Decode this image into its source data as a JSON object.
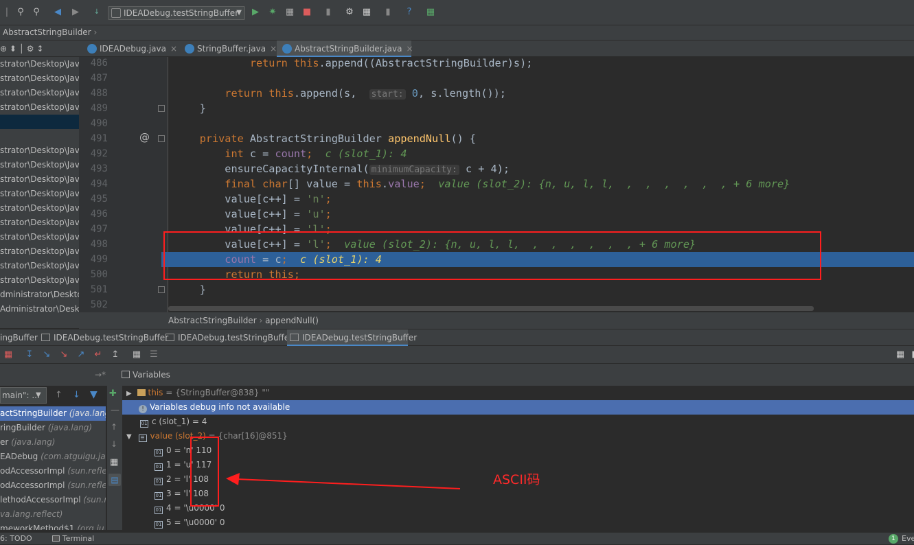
{
  "run_config": "IDEADebug.testStringBuffer",
  "breadcrumb_top": "AbstractStringBuilder",
  "project_tools": "⊕ ⬍ │ ⚙ ↕",
  "editor_tabs": [
    {
      "label": "IDEADebug.java",
      "active": false
    },
    {
      "label": "StringBuffer.java",
      "active": false
    },
    {
      "label": "AbstractStringBuilder.java",
      "active": true
    }
  ],
  "project_rows": [
    "strator\\Desktop\\Jav",
    "strator\\Desktop\\Jav",
    "strator\\Desktop\\Jav",
    "strator\\Desktop\\Jav",
    "",
    "strator\\Desktop\\Jav",
    "strator\\Desktop\\Jav",
    "strator\\Desktop\\Jav",
    "strator\\Desktop\\Jav",
    "strator\\Desktop\\Jav",
    "strator\\Desktop\\Jav",
    "strator\\Desktop\\Jav",
    "strator\\Desktop\\Jav",
    "strator\\Desktop\\Jav",
    "strator\\Desktop\\Jav",
    "dministrator\\Desktop\\",
    "Administrator\\Deskt"
  ],
  "line_numbers": [
    "486",
    "487",
    "488",
    "489",
    "490",
    "491",
    "492",
    "493",
    "494",
    "495",
    "496",
    "497",
    "498",
    "499",
    "500",
    "501",
    "502"
  ],
  "code": {
    "l486": {
      "kw1": "return",
      "kw2": "this",
      "rest": ".append((AbstractStringBuilder)s);"
    },
    "l488": {
      "kw1": "return",
      "kw2": "this",
      "mid": ".append(s, ",
      "hint": "start:",
      "num": "0",
      "rest": ", s.length());"
    },
    "l489": "}",
    "l491": {
      "kw": "private",
      "type": " AbstractStringBuilder ",
      "fn": "appendNull",
      "rest": "() {"
    },
    "l492": {
      "kw": "int",
      "mid": " c = ",
      "fld": "count",
      "semi": ";",
      "inline": "c (slot_1): 4"
    },
    "l493": {
      "pre": "ensureCapacityInternal(",
      "hint": "minimumCapacity:",
      "post": " c + 4);"
    },
    "l494": {
      "kw1": "final",
      "kw2": "char",
      "mid": "[] value = ",
      "kw3": "this",
      "dot": ".",
      "fld": "value",
      "semi": ";",
      "inline": "value (slot_2): {n, u, l, l,  ,  ,  ,  ,  ,  , + 6 more}"
    },
    "l495": {
      "pre": "value[c++] = ",
      "str": "'n'",
      "semi": ";"
    },
    "l496": {
      "pre": "value[c++] = ",
      "str": "'u'",
      "semi": ";"
    },
    "l497": {
      "pre": "value[c++] = ",
      "str": "'l'",
      "semi": ";"
    },
    "l498": {
      "pre": "value[c++] = ",
      "str": "'l'",
      "semi": ";",
      "inline": "value (slot_2): {n, u, l, l,  ,  ,  ,  ,  ,  , + 6 more}"
    },
    "l499": {
      "fld": "count",
      "mid": " = c",
      "semi": ";",
      "inline": "c (slot_1): 4"
    },
    "l500": {
      "kw1": "return",
      "kw2": "this",
      "semi": ";"
    },
    "l501": "}"
  },
  "gutter_marker": "@",
  "breadcrumbs": [
    "AbstractStringBuilder",
    "appendNull()"
  ],
  "debug_tabs": [
    {
      "label": "ingBuffer",
      "active": false
    },
    {
      "label": "IDEADebug.testStringBuffer",
      "active": false
    },
    {
      "label": "IDEADebug.testStringBuffer",
      "active": false
    },
    {
      "label": "IDEADebug.testStringBuffer",
      "active": true
    }
  ],
  "frames_header_label": "→*",
  "variables_header": "Variables",
  "thread_select": "main\": ...",
  "frames": [
    {
      "name": "actStringBuilder",
      "pkg": "(java.lang)",
      "sel": true
    },
    {
      "name": "ringBuilder",
      "pkg": "(java.lang)",
      "sel": false
    },
    {
      "name": "er",
      "pkg": "(java.lang)",
      "sel": false
    },
    {
      "name": "EADebug",
      "pkg": "(com.atguigu.java",
      "sel": false
    },
    {
      "name": "odAccessorImpl",
      "pkg": "(sun.reflec",
      "sel": false
    },
    {
      "name": "odAccessorImpl",
      "pkg": "(sun.reflec",
      "sel": false
    },
    {
      "name": "lethodAccessorImpl",
      "pkg": "(sun.r",
      "sel": false
    },
    {
      "name": "",
      "pkg": "va.lang.reflect)",
      "sel": false
    },
    {
      "name": "meworkMethod$1",
      "pkg": "(org.ju",
      "sel": false
    }
  ],
  "variables": {
    "this_row": {
      "name": "this",
      "value": "= {StringBuffer@838} \"\""
    },
    "info_row": "Variables debug info not available",
    "c_row": "c (slot_1) = 4",
    "value_row": {
      "name": "value (slot_2)",
      "value": "= {char[16]@851}"
    },
    "items": [
      "0 = 'n' 110",
      "1 = 'u' 117",
      "2 = 'l' 108",
      "3 = 'l' 108",
      "4 = '\\u0000' 0",
      "5 = '\\u0000' 0"
    ]
  },
  "annotation": "ASCII码",
  "status": {
    "todo": "6: TODO",
    "terminal": "Terminal",
    "event": "Eve",
    "event_count": "1"
  },
  "colors": {
    "accent": "#4a88c7",
    "exec_line": "#2d6099",
    "annotation_red": "#ff1e1e"
  }
}
